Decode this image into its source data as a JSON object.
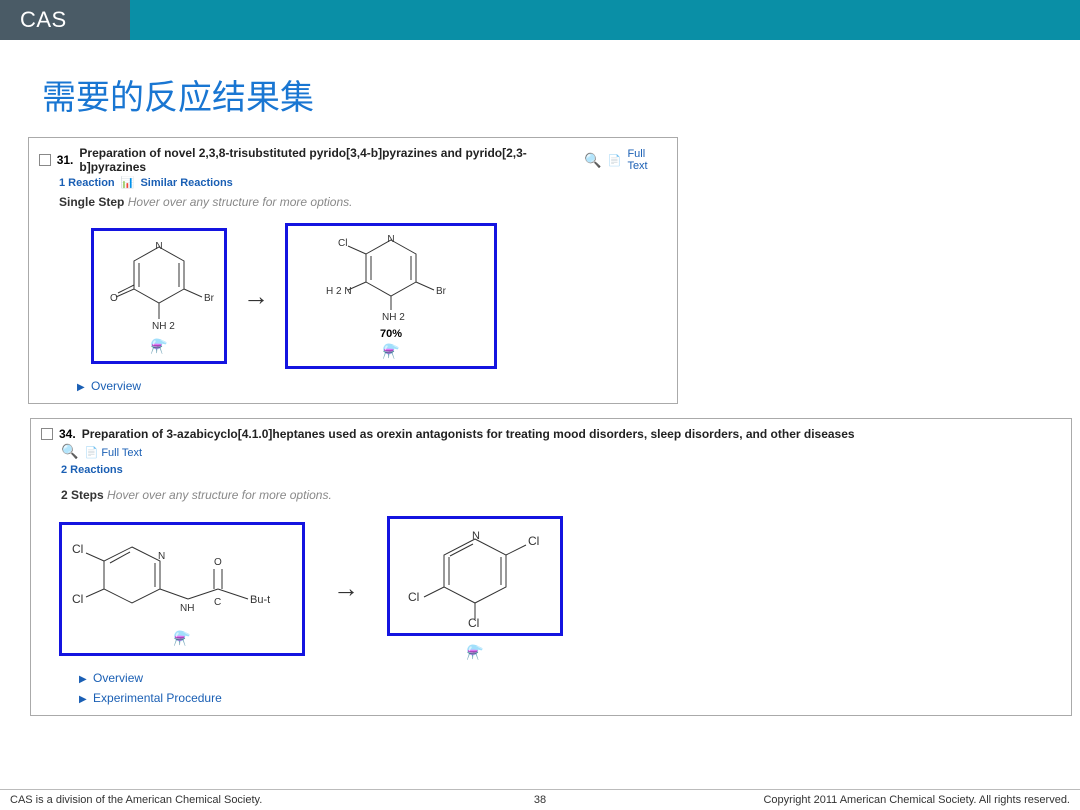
{
  "header": {
    "logo": "CAS"
  },
  "slide": {
    "title": "需要的反应结果集"
  },
  "card1": {
    "num": "31.",
    "title": "Preparation of novel 2,3,8-trisubstituted pyrido[3,4-b]pyrazines and pyrido[2,3-b]pyrazines",
    "fulltext": "Full Text",
    "links": {
      "reactions": "1 Reaction",
      "similar": "Similar Reactions"
    },
    "step_bold": "Single Step",
    "step_grey": "Hover over any structure for more options.",
    "mol1": {
      "n": "N",
      "o": "O",
      "br": "Br",
      "nh2": "NH 2"
    },
    "mol2": {
      "cl": "Cl",
      "n": "N",
      "h2n": "H 2 N",
      "br": "Br",
      "nh2": "NH 2",
      "yield": "70%"
    },
    "overview": "Overview"
  },
  "card2": {
    "num": "34.",
    "title": "Preparation of 3-azabicyclo[4.1.0]heptanes used as orexin antagonists for treating mood disorders, sleep disorders, and other diseases",
    "fulltext": "Full Text",
    "links": {
      "reactions": "2 Reactions"
    },
    "step_bold": "2 Steps",
    "step_grey": "Hover over any structure for more options.",
    "mol1": {
      "cl1": "Cl",
      "cl2": "Cl",
      "n": "N",
      "nh": "NH",
      "c": "C",
      "o": "O",
      "but": "Bu-t"
    },
    "mol2": {
      "n": "N",
      "cl1": "Cl",
      "cl2": "Cl",
      "cl3": "Cl"
    },
    "overview": "Overview",
    "exp": "Experimental Procedure"
  },
  "footer": {
    "left": "CAS is a division of the American Chemical Society.",
    "page": "38",
    "right": "Copyright 2011 American Chemical Society. All rights reserved."
  }
}
